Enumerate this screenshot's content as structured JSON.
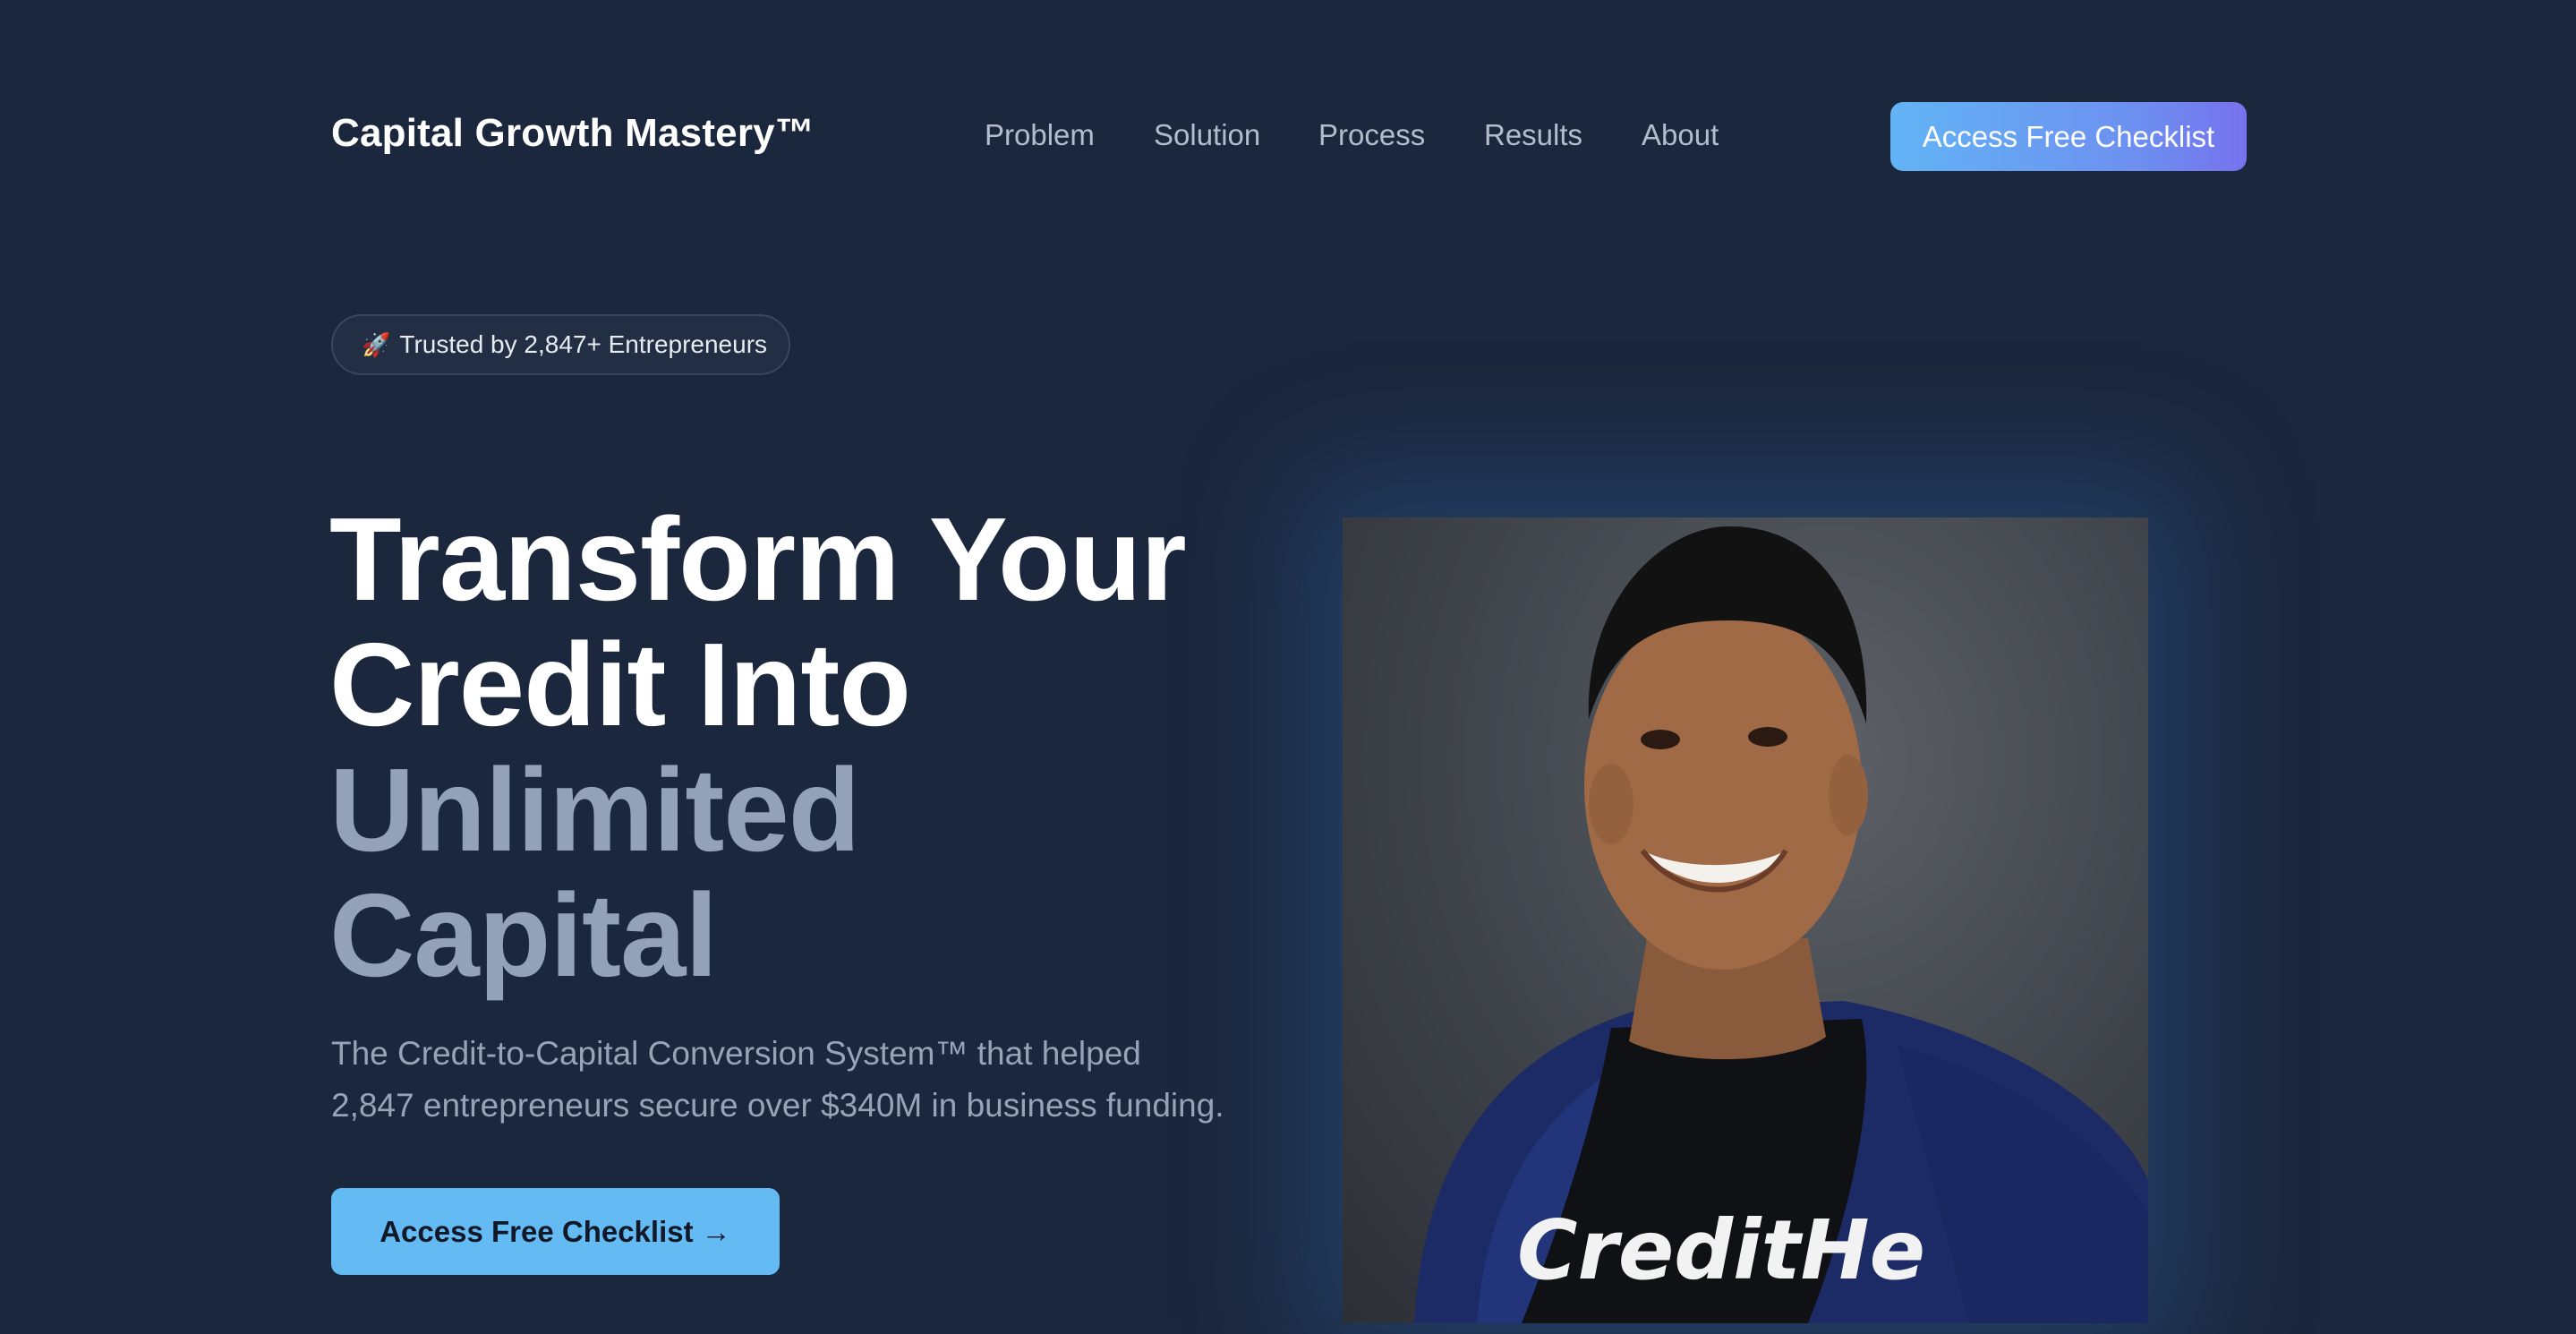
{
  "header": {
    "brand": "Capital Growth Mastery™",
    "nav": [
      "Problem",
      "Solution",
      "Process",
      "Results",
      "About"
    ],
    "cta_label": "Access Free Checklist"
  },
  "hero": {
    "badge_icon": "rocket-icon",
    "badge_text": "Trusted by 2,847+ Entrepreneurs",
    "headline_white": [
      "Transform Your",
      "Credit Into"
    ],
    "headline_muted": [
      "Unlimited",
      "Capital"
    ],
    "subtext": "The Credit-to-Capital Conversion System™ that helped 2,847 entrepreneurs secure over $340M in business funding.",
    "cta_label": "Access Free Checklist →",
    "photo_shirt_text": "CreditHe"
  },
  "colors": {
    "background": "#1b273d",
    "muted_heading": "#94a2b7",
    "cta_main": "#64baf3",
    "cta_top_gradient_start": "#62b4f5",
    "cta_top_gradient_end": "#7672ee"
  }
}
